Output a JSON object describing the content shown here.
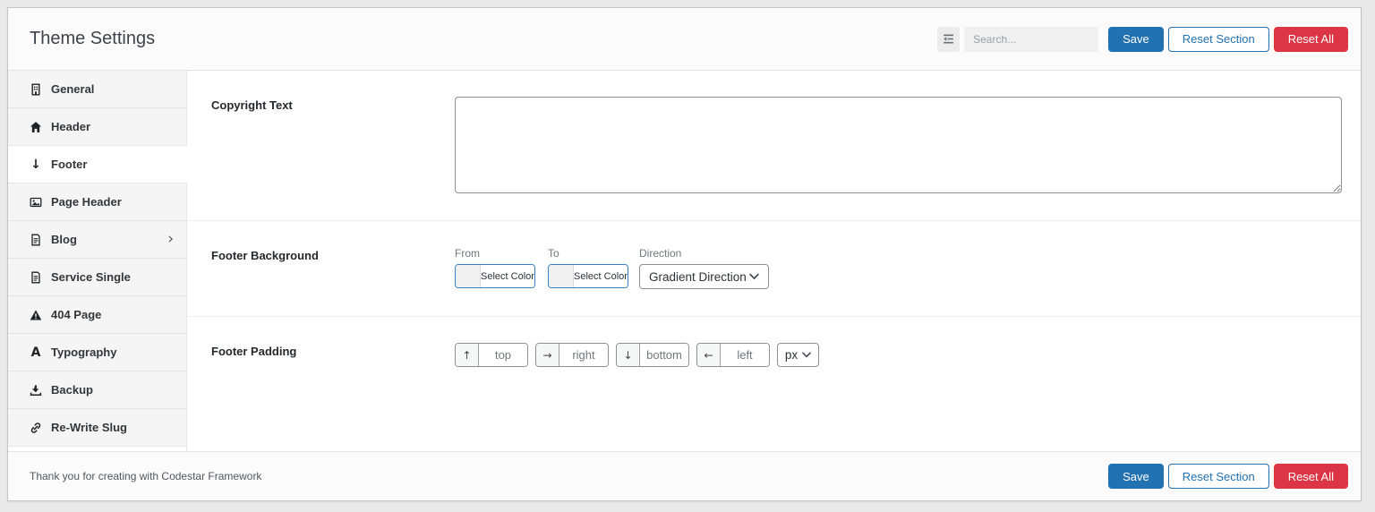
{
  "page": {
    "title": "Theme Settings"
  },
  "toolbar": {
    "search_placeholder": "Search...",
    "save_label": "Save",
    "reset_section_label": "Reset Section",
    "reset_all_label": "Reset All"
  },
  "sidebar": {
    "items": [
      {
        "label": "General",
        "icon": "building-icon",
        "active": false
      },
      {
        "label": "Header",
        "icon": "home-icon",
        "active": false
      },
      {
        "label": "Footer",
        "icon": "arrow-down-icon",
        "active": true
      },
      {
        "label": "Page Header",
        "icon": "image-icon",
        "active": false
      },
      {
        "label": "Blog",
        "icon": "document-icon",
        "active": false,
        "has_submenu": true
      },
      {
        "label": "Service Single",
        "icon": "document-icon",
        "active": false
      },
      {
        "label": "404 Page",
        "icon": "warning-icon",
        "active": false
      },
      {
        "label": "Typography",
        "icon": "letter-a-icon",
        "active": false
      },
      {
        "label": "Backup",
        "icon": "download-icon",
        "active": false
      },
      {
        "label": "Re-Write Slug",
        "icon": "link-icon",
        "active": false
      }
    ]
  },
  "fields": {
    "copyright": {
      "label": "Copyright Text",
      "value": ""
    },
    "footer_background": {
      "label": "Footer Background",
      "from_label": "From",
      "to_label": "To",
      "direction_label": "Direction",
      "select_color_label": "Select Color",
      "direction_value": "Gradient Direction"
    },
    "footer_padding": {
      "label": "Footer Padding",
      "top_placeholder": "top",
      "right_placeholder": "right",
      "bottom_placeholder": "bottom",
      "left_placeholder": "left",
      "unit_value": "px"
    }
  },
  "footer": {
    "thanks_text": "Thank you for creating with Codestar Framework",
    "save_label": "Save",
    "reset_section_label": "Reset Section",
    "reset_all_label": "Reset All"
  },
  "icons": {
    "arrow_up": "↑",
    "arrow_right": "→",
    "arrow_down": "↓",
    "arrow_left": "←",
    "chevron_right": "›",
    "typography_glyph": "A"
  },
  "colors": {
    "primary_blue": "#2271b1",
    "danger_red": "#dc3545",
    "color_picker_border": "#3582c4"
  }
}
